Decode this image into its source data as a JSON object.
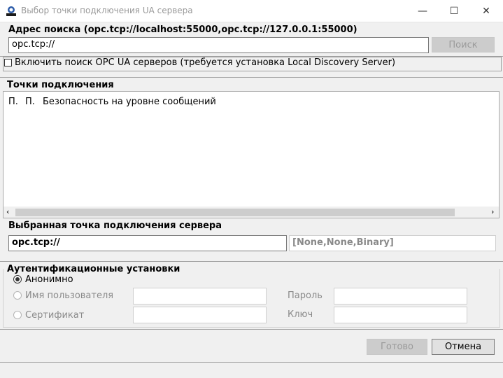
{
  "window": {
    "title": "Выбор точки подключения UA сервера",
    "app_icon": "opc-logo-icon",
    "minimize_glyph": "—",
    "maximize_glyph": "☐",
    "close_glyph": "✕"
  },
  "search": {
    "label": "Адрес поиска (opc.tcp://localhost:55000,opc.tcp://127.0.0.1:55000)",
    "value": "opc.tcp://",
    "button_label": "Поиск"
  },
  "discovery": {
    "checkbox_label": "Включить поиск OPC UA серверов (требуется установка Local Discovery Server)",
    "checked": false
  },
  "endpoints": {
    "section_label": "Точки подключения",
    "columns": [
      "П.",
      "П.",
      "Безопасность на уровне сообщений"
    ],
    "rows": []
  },
  "selected": {
    "label": "Выбранная точка подключения сервера",
    "value": "opc.tcp://",
    "security": "[None,None,Binary]"
  },
  "auth": {
    "section_label": "Аутентификационные установки",
    "anonymous_label": "Анонимно",
    "username_label": "Имя пользователя",
    "password_label": "Пароль",
    "certificate_label": "Сертификат",
    "key_label": "Ключ",
    "selected": "anonymous"
  },
  "footer": {
    "ok_label": "Готово",
    "cancel_label": "Отмена"
  }
}
